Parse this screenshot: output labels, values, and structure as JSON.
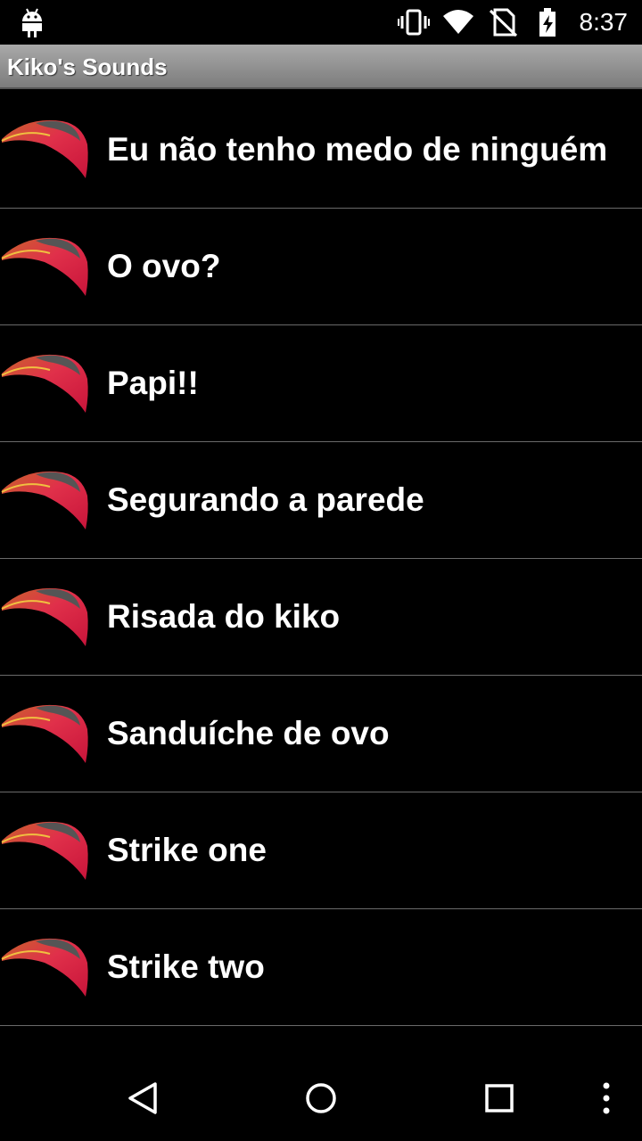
{
  "status_bar": {
    "time": "8:37",
    "icons": [
      "android-icon",
      "vibrate-icon",
      "wifi-icon",
      "no-sim-icon",
      "battery-charging-icon"
    ]
  },
  "title_bar": {
    "title": "Kiko's Sounds"
  },
  "sounds": [
    {
      "label": "Eu não tenho medo de ninguém",
      "icon": "kiko-hat-icon"
    },
    {
      "label": "O ovo?",
      "icon": "kiko-hat-icon"
    },
    {
      "label": "Papi!!",
      "icon": "kiko-hat-icon"
    },
    {
      "label": "Segurando a parede",
      "icon": "kiko-hat-icon"
    },
    {
      "label": "Risada do kiko",
      "icon": "kiko-hat-icon"
    },
    {
      "label": "Sanduíche de ovo",
      "icon": "kiko-hat-icon"
    },
    {
      "label": "Strike one",
      "icon": "kiko-hat-icon"
    },
    {
      "label": "Strike two",
      "icon": "kiko-hat-icon"
    }
  ],
  "nav_bar": {
    "buttons": [
      "back-icon",
      "home-icon",
      "recents-icon",
      "overflow-menu-icon"
    ]
  },
  "colors": {
    "background": "#000000",
    "title_bar": "#8f8f8f",
    "divider": "#6a6a6a",
    "text": "#ffffff"
  }
}
